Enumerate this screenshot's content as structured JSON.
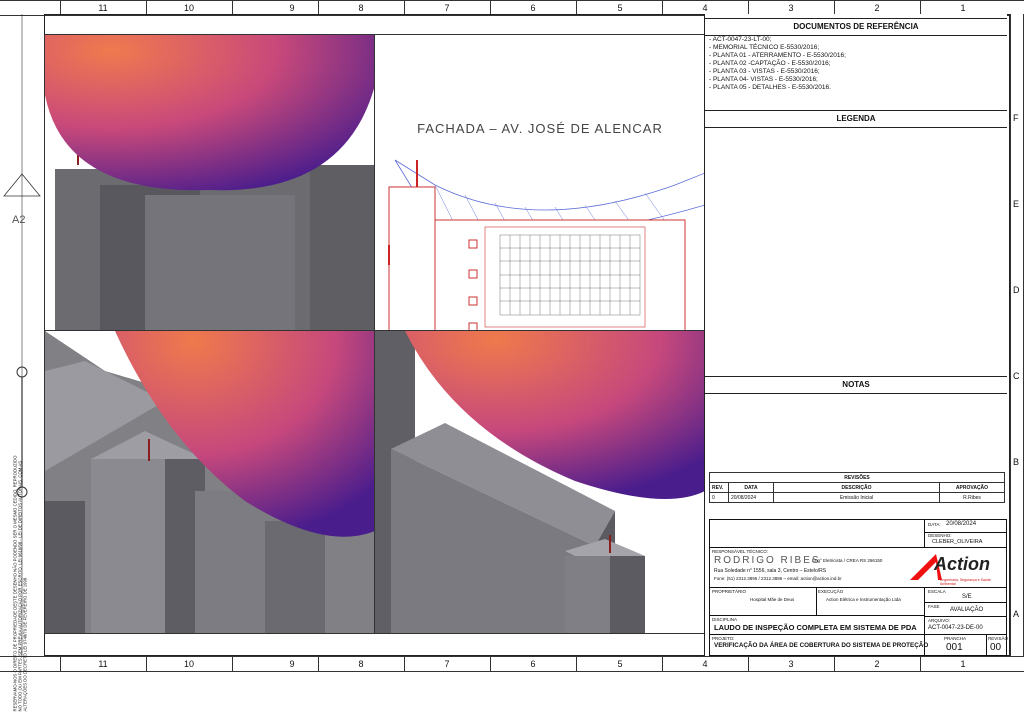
{
  "ruler_top": [
    "11",
    "10",
    "9",
    "8",
    "7",
    "6",
    "5",
    "4",
    "3",
    "2",
    "1"
  ],
  "ruler_right": [
    "F",
    "E",
    "D",
    "C",
    "B",
    "A"
  ],
  "sheet_size": "A2",
  "side_note": "RESERVAMO-NOS O DIREITO DE PROPRIEDADE DESTE DESENHO NÃO PODENDO SER O MESMO CEDIDO, REPRODUZIDO NO TODO OU EM PARTES, SEM PRÉVIA AUTORIZAÇÃO POR ESCRITO. LEI 9610/98 - LEI DE DIREITOS AUTORAIS. COM AS ALTERAÇÕES DO DECRETO LEI 9748/79 DE FEVEREIRO DE 1998",
  "facade_title": "FACHADA – AV. JOSÉ DE ALENCAR",
  "ref_header": "DOCUMENTOS DE REFERÊNCIA",
  "refs": [
    "- ACT-0047-23-LT-00;",
    "- MEMORIAL TÉCNICO E-5530/2016;",
    "- PLANTA 01 - ATERRAMENTO - E-5530/2016;",
    "- PLANTA 02 -CAPTAÇÃO - E-5530/2016;",
    "- PLANTA 03 - VISTAS - E-5530/2016;",
    "- PLANTA 04- VISTAS - E-5530/2016;",
    "- PLANTA 05 - DETALHES - E-5530/2016."
  ],
  "legend_header": "LEGENDA",
  "notes_header": "NOTAS",
  "revisions": {
    "title": "REVISÕES",
    "cols": [
      "REV.",
      "DATA",
      "DESCRIÇÃO",
      "APROVAÇÃO"
    ],
    "rows": [
      [
        "0",
        "20/08/2024",
        "Emissão Inicial",
        "R.Ribes"
      ]
    ]
  },
  "title_block": {
    "date_label": "DATA:",
    "date": "20/08/2024",
    "drawn_label": "DESENHO:",
    "drawn": "CLEBER_OLIVEIRA",
    "resp_label": "RESPONSÁVEL TÉCNICO:",
    "engineer": "RODRIGO RIBES",
    "engineer_title": "Eng° Eletricista / CREA RS 266150",
    "address": "Rua Soledade n° 1556, sala 3, Centro – Estelo/RS",
    "contact": "Fone: (51) 2312.3895 / 2312.3886 – email: action@action.ind.br",
    "logo": "Action",
    "logo_tag": "Engenharia, Segurança e Saúde Ambiental",
    "scale_label": "ESCALA",
    "scale": "S/E",
    "phase_label": "FASE",
    "phase": "AVALIAÇÃO",
    "owner_label": "PROPRIETÁRIO",
    "owner": "Hospital Mãe de Deus",
    "exec_label": "EXECUÇÃO",
    "exec": "Action Elétrica e Instrumentação Ltda",
    "disc_label": "DISCIPLINA",
    "discipline": "LAUDO DE INSPEÇÃO COMPLETA EM SISTEMA DE PDA",
    "file_label": "ARQUIVO:",
    "file": "ACT-0047-23-DE-00",
    "proj_label": "PROJETO:",
    "project": "VERIFICAÇÃO DA ÁREA DE COBERTURA DO SISTEMA DE PROTEÇÃO",
    "sheet_label": "PRANCHA",
    "sheet": "001",
    "rev_label": "REVISÃO",
    "rev": "00"
  }
}
